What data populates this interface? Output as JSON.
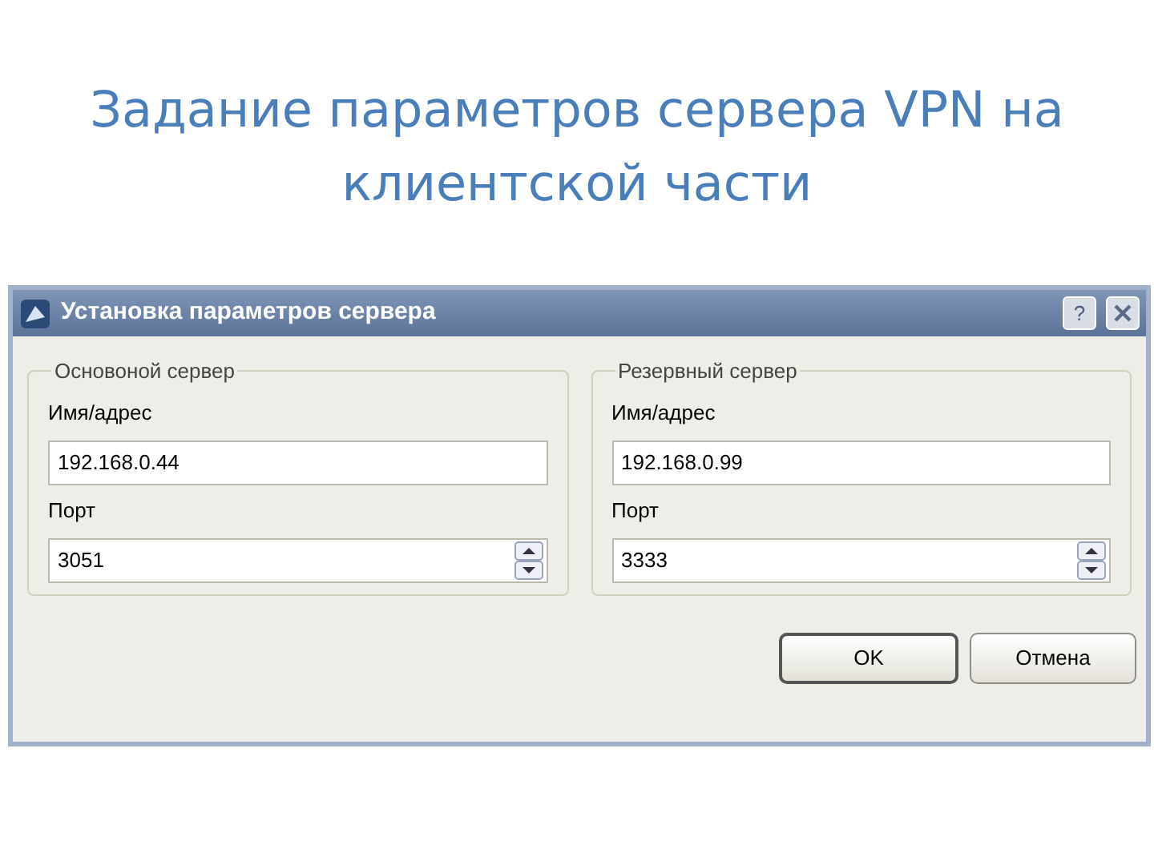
{
  "slide_title": "Задание параметров сервера VPN на клиентской части",
  "dialog": {
    "title": "Установка параметров сервера",
    "help_button": "?",
    "groups": [
      {
        "legend": "Основоной сервер",
        "fields": [
          {
            "kind": "text",
            "label": "Имя/адрес",
            "value": "192.168.0.44"
          },
          {
            "kind": "spin",
            "label": "Порт",
            "value": "3051"
          }
        ]
      },
      {
        "legend": "Резервный сервер",
        "fields": [
          {
            "kind": "text",
            "label": "Имя/адрес",
            "value": "192.168.0.99"
          },
          {
            "kind": "spin",
            "label": "Порт",
            "value": "3333"
          }
        ]
      }
    ],
    "buttons": [
      {
        "label": "OK",
        "default": true
      },
      {
        "label": "Отмена",
        "default": false
      }
    ]
  }
}
